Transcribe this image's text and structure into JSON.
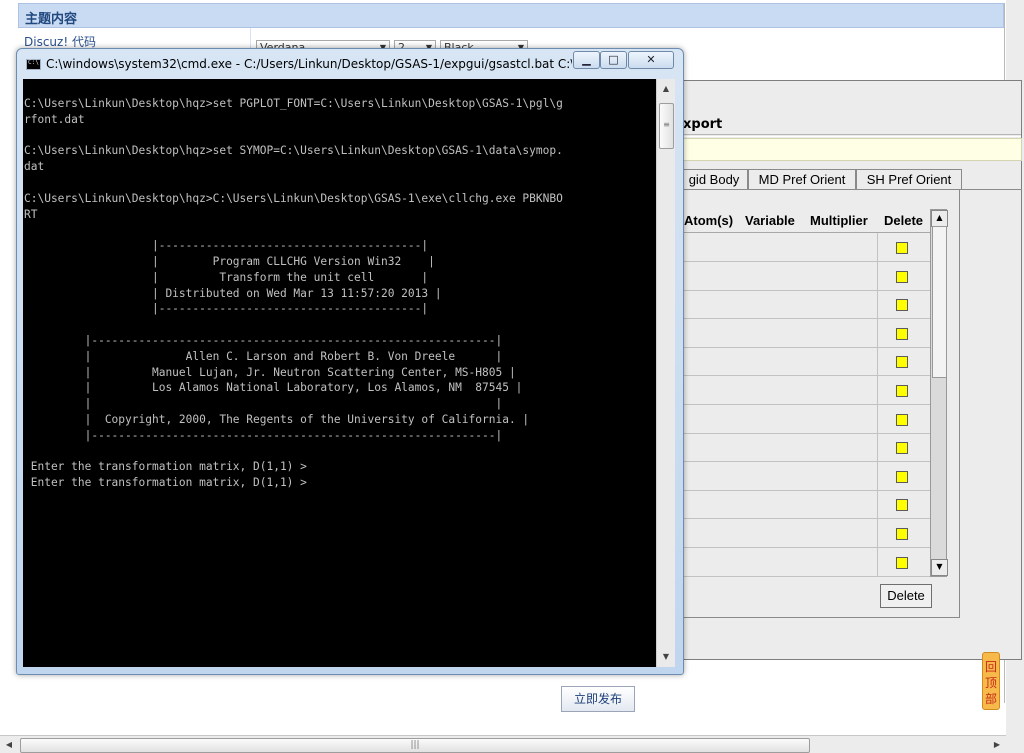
{
  "forum": {
    "section_title": "主题内容",
    "code_label": "Discuz! 代码",
    "font_select": "Verdana",
    "size_select": "2",
    "color_select": "Black",
    "publish_label": "立即发布",
    "side_tag_label": "回顶部"
  },
  "gsas": {
    "title_fragment": "xport",
    "tabs": [
      {
        "label": "gid Body"
      },
      {
        "label": "MD Pref Orient"
      },
      {
        "label": "SH Pref Orient"
      }
    ],
    "columns": [
      {
        "label": "Atom(s)"
      },
      {
        "label": "Variable"
      },
      {
        "label": "Multiplier"
      },
      {
        "label": "Delete"
      }
    ],
    "row_count": 12,
    "delete_label": "Delete"
  },
  "cmd": {
    "title": "C:\\windows\\system32\\cmd.exe - C:/Users/Linkun/Desktop/GSAS-1/expgui/gsastcl.bat   C:\\...",
    "lines": [
      "C:\\Users\\Linkun\\Desktop\\hqz>set PGPLOT_FONT=C:\\Users\\Linkun\\Desktop\\GSAS-1\\pgl\\g",
      "rfont.dat",
      "",
      "C:\\Users\\Linkun\\Desktop\\hqz>set SYMOP=C:\\Users\\Linkun\\Desktop\\GSAS-1\\data\\symop.",
      "dat",
      "",
      "C:\\Users\\Linkun\\Desktop\\hqz>C:\\Users\\Linkun\\Desktop\\GSAS-1\\exe\\cllchg.exe PBKNBO",
      "RT",
      "",
      "                   |---------------------------------------|",
      "                   |        Program CLLCHG Version Win32    |",
      "                   |         Transform the unit cell       |",
      "                   | Distributed on Wed Mar 13 11:57:20 2013 |",
      "                   |---------------------------------------|",
      "",
      "         |------------------------------------------------------------|",
      "         |              Allen C. Larson and Robert B. Von Dreele      |",
      "         |         Manuel Lujan, Jr. Neutron Scattering Center, MS-H805 |",
      "         |         Los Alamos National Laboratory, Los Alamos, NM  87545 |",
      "         |                                                            |",
      "         |  Copyright, 2000, The Regents of the University of California. |",
      "         |------------------------------------------------------------|",
      "",
      " Enter the transformation matrix, D(1,1) >",
      " Enter the transformation matrix, D(1,1) >"
    ]
  }
}
